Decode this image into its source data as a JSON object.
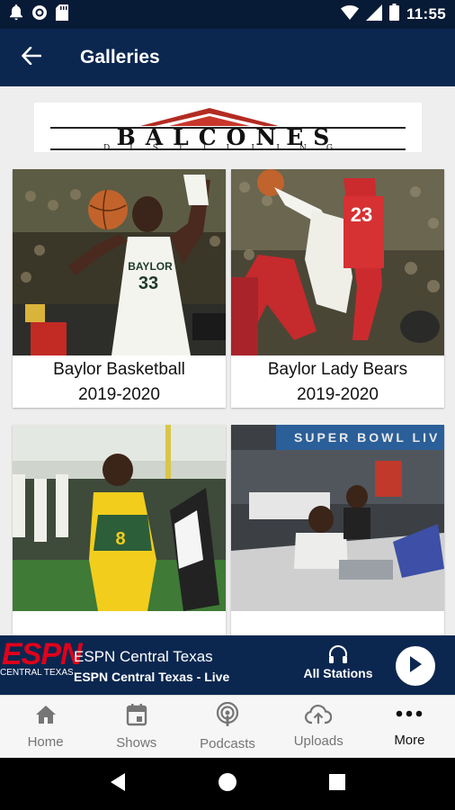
{
  "status_bar": {
    "time": "11:55"
  },
  "app_bar": {
    "title": "Galleries"
  },
  "banner": {
    "line1": "BALCONES",
    "line2": "DISTILLING"
  },
  "galleries": [
    {
      "line1": "Baylor Basketball",
      "line2": "2019-2020"
    },
    {
      "line1": "Baylor Lady Bears",
      "line2": "2019-2020"
    },
    {
      "line1": "",
      "line2": ""
    },
    {
      "line1": "",
      "line2": ""
    }
  ],
  "player": {
    "logo_text": "ESPN",
    "logo_sub": "CENTRAL TEXAS",
    "station_title": "ESPN Central Texas",
    "station_sub": "ESPN Central Texas - Live",
    "all_stations": "All Stations",
    "image_text": {
      "number_1": "33",
      "jersey_1": "BAYLOR",
      "number_2": "23",
      "super_bowl": "SUPER BOWL LIV"
    }
  },
  "bottom_nav": [
    {
      "label": "Home",
      "icon": "home-icon",
      "active": false
    },
    {
      "label": "Shows",
      "icon": "calendar-icon",
      "active": false
    },
    {
      "label": "Podcasts",
      "icon": "podcast-icon",
      "active": false
    },
    {
      "label": "Uploads",
      "icon": "cloud-upload-icon",
      "active": false
    },
    {
      "label": "More",
      "icon": "more-horizontal-icon",
      "active": true
    }
  ],
  "colors": {
    "primary": "#0b2750",
    "status_bar": "#071a36",
    "espn_red": "#e0001b",
    "background": "#eeeeee"
  }
}
